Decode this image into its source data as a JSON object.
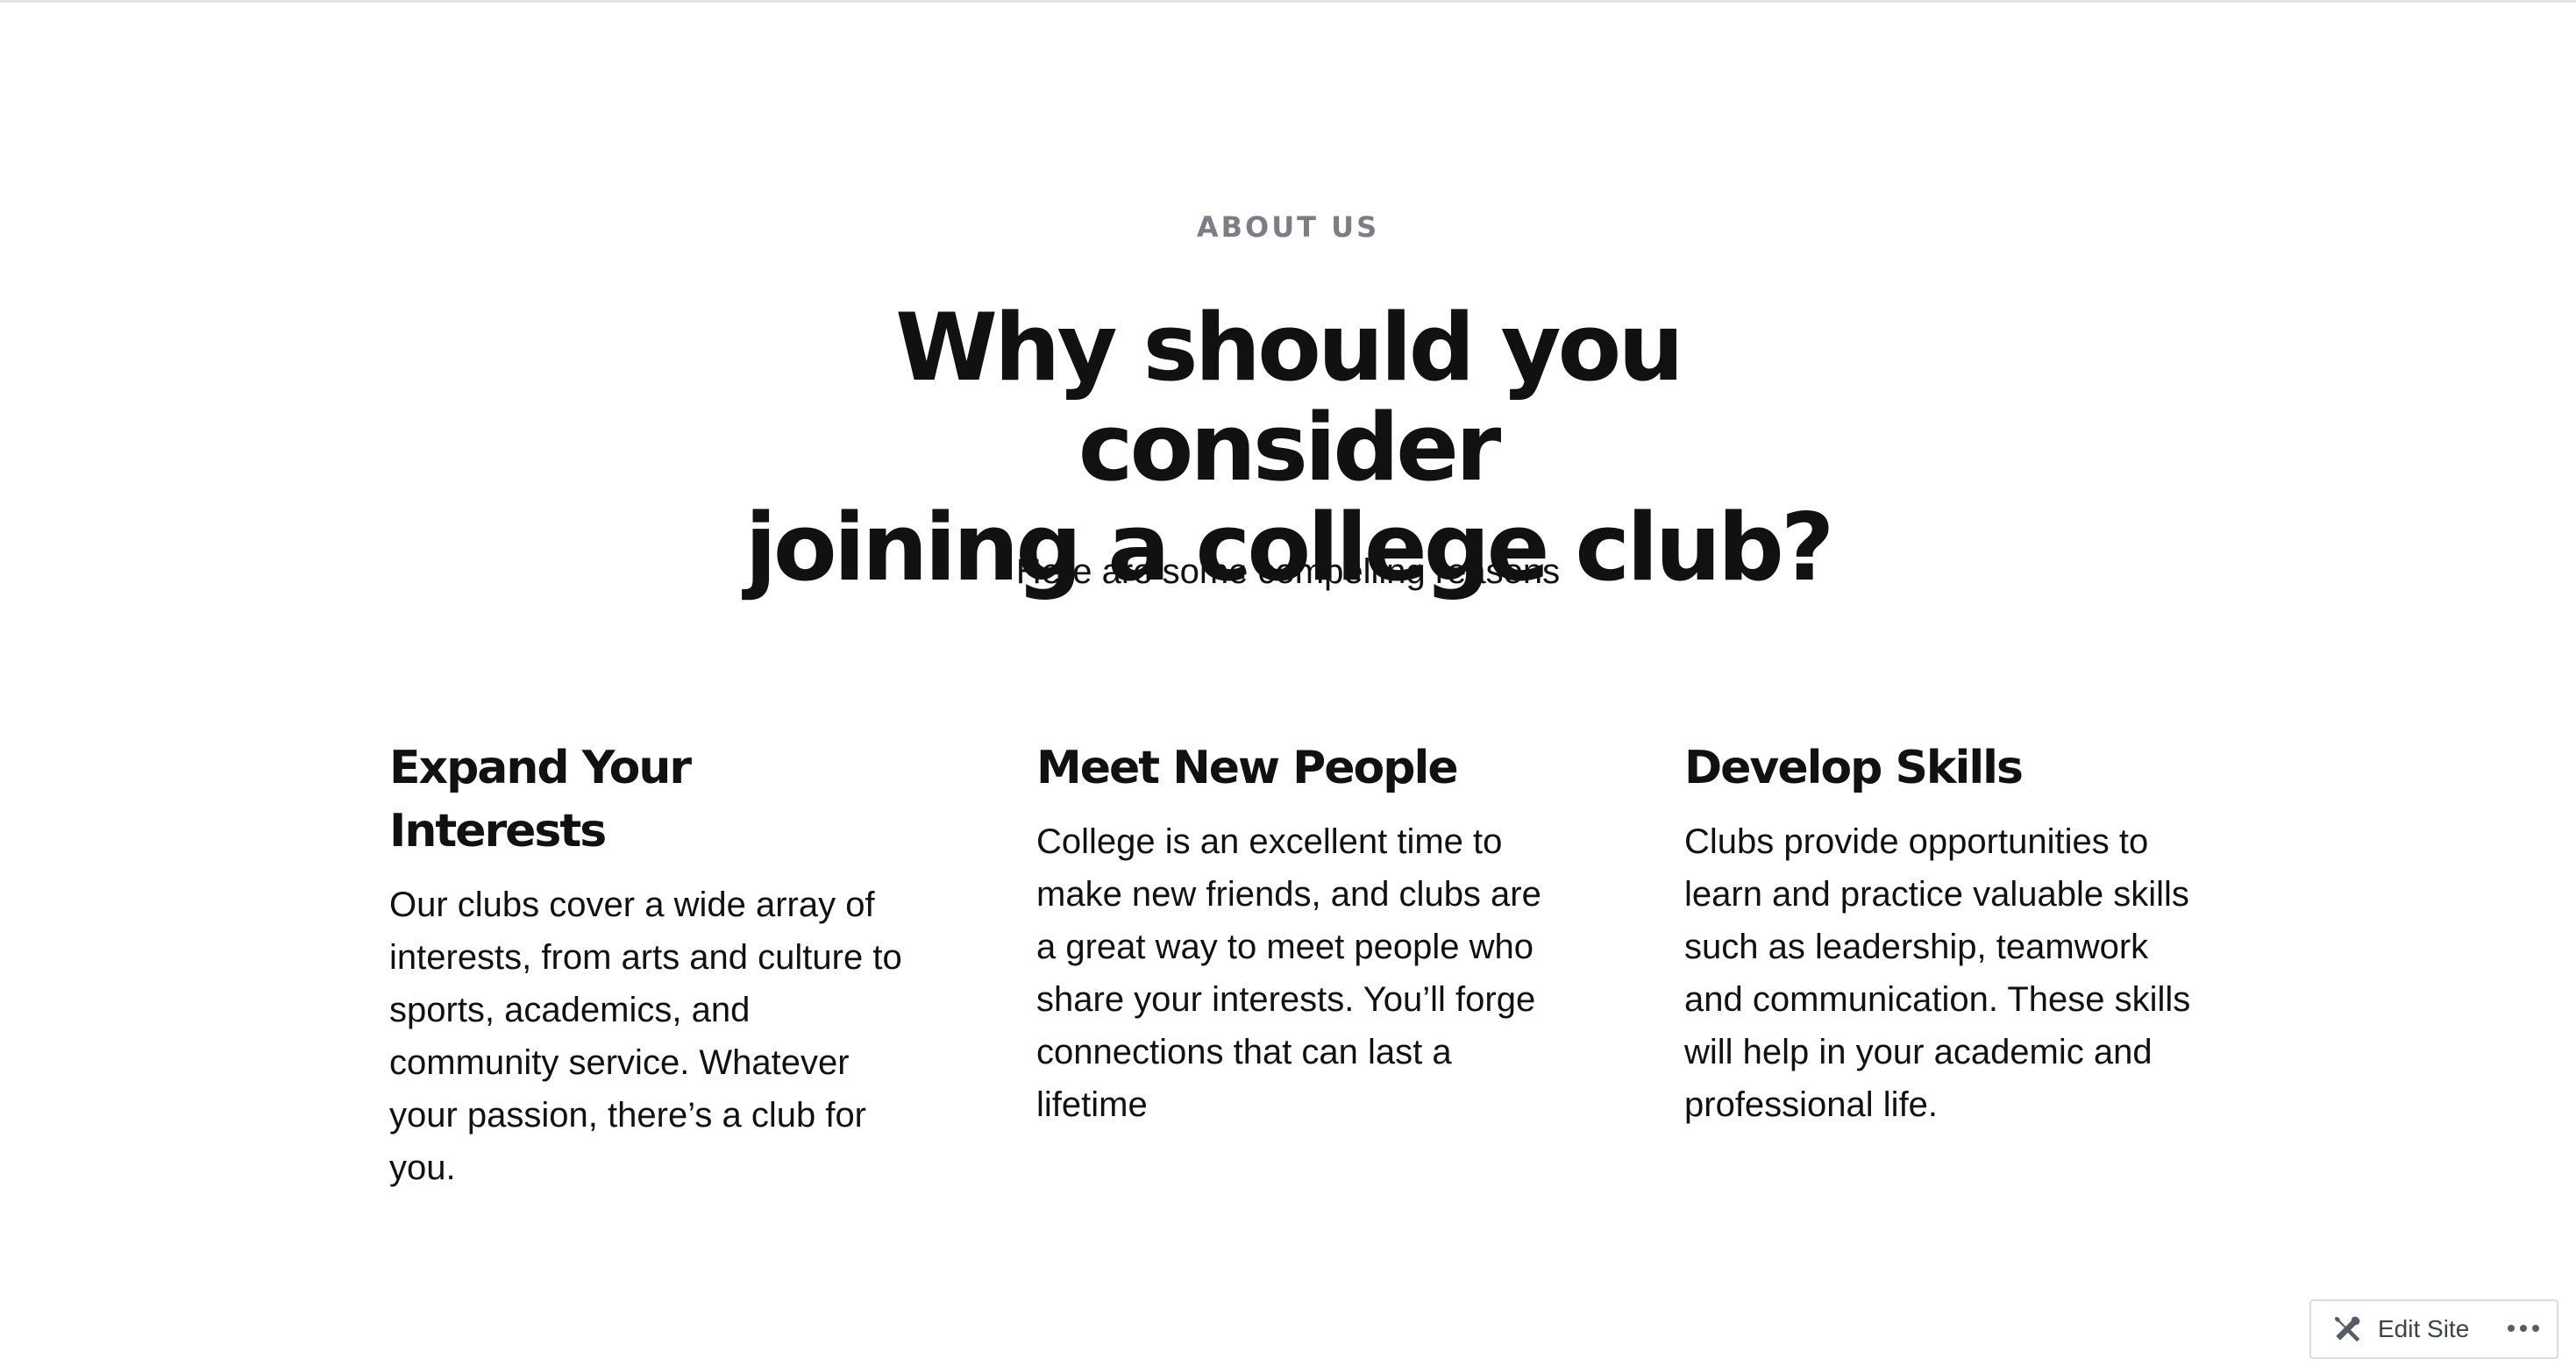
{
  "about": {
    "eyebrow": "ABOUT US",
    "headline_line1": "Why should you consider",
    "headline_line2": "joining a college club?",
    "subhead": "Here are some compelling reasons"
  },
  "features": [
    {
      "title": "Expand Your Interests",
      "text": "Our clubs cover a wide array of interests, from arts and culture to sports, academics, and community service. Whatever your passion, there’s a club for you."
    },
    {
      "title": "Meet New People",
      "text": "College is an excellent time to make new friends, and clubs are a great way to meet people who share your interests. You’ll forge connections that can last a lifetime"
    },
    {
      "title": "Develop Skills",
      "text": "Clubs provide opportunities to learn and practice valuable skills such as leadership, teamwork and communication. These skills will help in your academic and professional life."
    }
  ],
  "admin_bar": {
    "edit_label": "Edit Site",
    "edit_icon": "tools-icon",
    "more_icon": "ellipsis-icon"
  },
  "colors": {
    "eyebrow": "#7d7d86",
    "text": "#111111",
    "admin_text": "#3c434a"
  }
}
